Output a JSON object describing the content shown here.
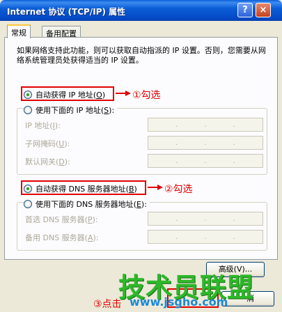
{
  "window": {
    "title": "Internet 协议 (TCP/IP) 属性",
    "help_glyph": "?",
    "close_glyph": "×"
  },
  "tabs": [
    {
      "label": "常规"
    },
    {
      "label": "备用配置"
    }
  ],
  "description": "如果网络支持此功能，则可以获取自动指派的 IP 设置。否则，您需要从网络系统管理员处获得适当的 IP 设置。",
  "ip_section": {
    "auto_label": "自动获得 IP 地址(",
    "auto_key": "O",
    "manual_label": "使用下面的 IP 地址(",
    "manual_key": "S",
    "fields": [
      {
        "label": "IP 地址(",
        "key": "I"
      },
      {
        "label": "子网掩码(",
        "key": "U"
      },
      {
        "label": "默认网关(",
        "key": "D"
      }
    ]
  },
  "dns_section": {
    "auto_label": "自动获得 DNS 服务器地址(",
    "auto_key": "B",
    "manual_label": "使用下面的 DNS 服务器地址(",
    "manual_key": "E",
    "fields": [
      {
        "label": "首选 DNS 服务器(",
        "key": "P"
      },
      {
        "label": "备用 DNS 服务器(",
        "key": "A"
      }
    ]
  },
  "ip_dots": ".",
  "paren_close": "):",
  "paren_close_plain": ")",
  "annotations": {
    "step1": "①勾选",
    "step2": "②勾选",
    "step3": "③点击"
  },
  "buttons": {
    "advanced": "高级(V)...",
    "cancel": "消"
  },
  "watermark": {
    "text": "技术员联盟",
    "url": "www.jsgho.com"
  },
  "colors": {
    "titlebar": "#0b5dd6",
    "annotation_red": "#e00000",
    "watermark_green": "#2db82a"
  }
}
